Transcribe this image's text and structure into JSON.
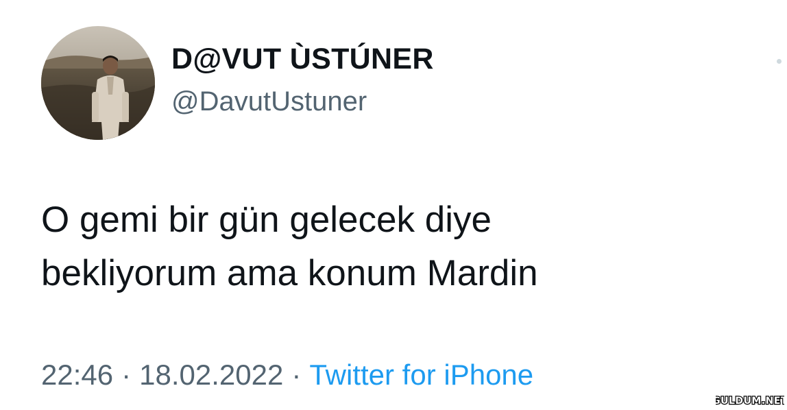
{
  "tweet": {
    "author": {
      "display_name": "D@VUT ÙSTÚNER",
      "handle": "@DavutUstuner"
    },
    "text_lines": [
      "O gemi bir gün gelecek diye",
      "bekliyorum ama konum Mardin"
    ],
    "time": "22:46",
    "separator": "·",
    "date": "18.02.2022",
    "source": "Twitter for iPhone"
  },
  "icons": {
    "more": "more-options-icon"
  },
  "watermark": {
    "text": "GULDUM.NET"
  },
  "colors": {
    "text_primary": "#0f1419",
    "text_secondary": "#536471",
    "link": "#1d9bf0"
  }
}
